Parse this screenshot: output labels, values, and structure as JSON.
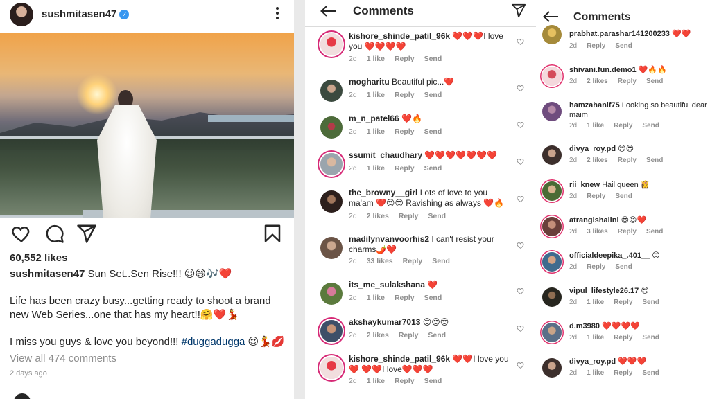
{
  "post": {
    "username": "sushmitasen47",
    "verified_glyph": "✓",
    "likes": "60,552 likes",
    "caption_user": "sushmitasen47",
    "caption_text": " Sun Set..Sen Rise!!! 😉😄🎶❤️",
    "body_line1": "Life has been crazy busy...getting ready to shoot a brand new Web Series...one that has my heart!!🤗❤️💃",
    "body_line2_text": "I miss you guys & love you beyond!!! ",
    "body_line2_hashtag": "#duggadugga",
    "body_line2_emoji": " 😍💃💋",
    "view_all": "View all 474 comments",
    "time": "2 days ago",
    "icons": [
      "heart-icon",
      "comment-icon",
      "share-icon",
      "bookmark-icon"
    ]
  },
  "comments_panel_a": {
    "title": "Comments",
    "items": [
      {
        "user": "kishore_shinde_patil_96k",
        "text": " ❤️❤️❤️I love you ❤️❤️❤️❤️",
        "time": "2d",
        "likes": "1 like",
        "reply": "Reply",
        "send": "Send"
      },
      {
        "user": "mogharitu",
        "text": " Beautiful pic...❤️",
        "time": "2d",
        "likes": "1 like",
        "reply": "Reply",
        "send": "Send"
      },
      {
        "user": "m_n_patel66",
        "text": " ❤️🔥",
        "time": "2d",
        "likes": "1 like",
        "reply": "Reply",
        "send": "Send"
      },
      {
        "user": "ssumit_chaudhary",
        "text": " ❤️❤️❤️❤️❤️❤️❤️",
        "time": "2d",
        "likes": "1 like",
        "reply": "Reply",
        "send": "Send"
      },
      {
        "user": "the_browny__girl",
        "text": " Lots of love to you ma'am ❤️😍😍 Ravishing as always ❤️🔥",
        "time": "2d",
        "likes": "2 likes",
        "reply": "Reply",
        "send": "Send"
      },
      {
        "user": "madilynvanvoorhis2",
        "text": " I can't resist your charms🌶️❤️",
        "time": "2d",
        "likes": "33 likes",
        "reply": "Reply",
        "send": "Send"
      },
      {
        "user": "its_me_sulakshana",
        "text": " ❤️",
        "time": "2d",
        "likes": "1 like",
        "reply": "Reply",
        "send": "Send"
      },
      {
        "user": "akshaykumar7013",
        "text": " 😍😍😍",
        "time": "2d",
        "likes": "2 likes",
        "reply": "Reply",
        "send": "Send"
      },
      {
        "user": "kishore_shinde_patil_96k",
        "text": " ❤️❤️I love you❤️ ❤️❤️I love❤️❤️❤️",
        "time": "2d",
        "likes": "1 like",
        "reply": "Reply",
        "send": "Send"
      }
    ]
  },
  "comments_panel_b": {
    "title": "Comments",
    "items": [
      {
        "user": "prabhat.parashar141200233",
        "text": " ❤️❤️",
        "time": "2d",
        "likes": "",
        "reply": "Reply",
        "send": "Send"
      },
      {
        "user": "shivani.fun.demo1",
        "text": " ❤️🔥🔥",
        "time": "2d",
        "likes": "2 likes",
        "reply": "Reply",
        "send": "Send"
      },
      {
        "user": "hamzahanif75",
        "text": " Looking so beautiful dear maim",
        "time": "2d",
        "likes": "1 like",
        "reply": "Reply",
        "send": "Send"
      },
      {
        "user": "divya_roy.pd",
        "text": " 😍😍",
        "time": "2d",
        "likes": "2 likes",
        "reply": "Reply",
        "send": "Send"
      },
      {
        "user": "rii_knew",
        "text": " Hail queen 👸",
        "time": "2d",
        "likes": "",
        "reply": "Reply",
        "send": "Send"
      },
      {
        "user": "atrangishalini",
        "text": " 😍😍❤️",
        "time": "2d",
        "likes": "3 likes",
        "reply": "Reply",
        "send": "Send"
      },
      {
        "user": "officialdeepika_.401__",
        "text": " 😍",
        "time": "2d",
        "likes": "",
        "reply": "Reply",
        "send": "Send"
      },
      {
        "user": "vipul_lifestyle26.17",
        "text": " 😍",
        "time": "2d",
        "likes": "1 like",
        "reply": "Reply",
        "send": "Send"
      },
      {
        "user": "d.m3980",
        "text": " ❤️❤️❤️❤️",
        "time": "2d",
        "likes": "1 like",
        "reply": "Reply",
        "send": "Send"
      },
      {
        "user": "divya_roy.pd",
        "text": " ❤️❤️❤️",
        "time": "2d",
        "likes": "1 like",
        "reply": "Reply",
        "send": "Send"
      }
    ]
  },
  "colors": {
    "story_ring": "#d62976",
    "hashtag": "#00376b",
    "muted": "#8e8e8e",
    "verified": "#3897f0"
  }
}
